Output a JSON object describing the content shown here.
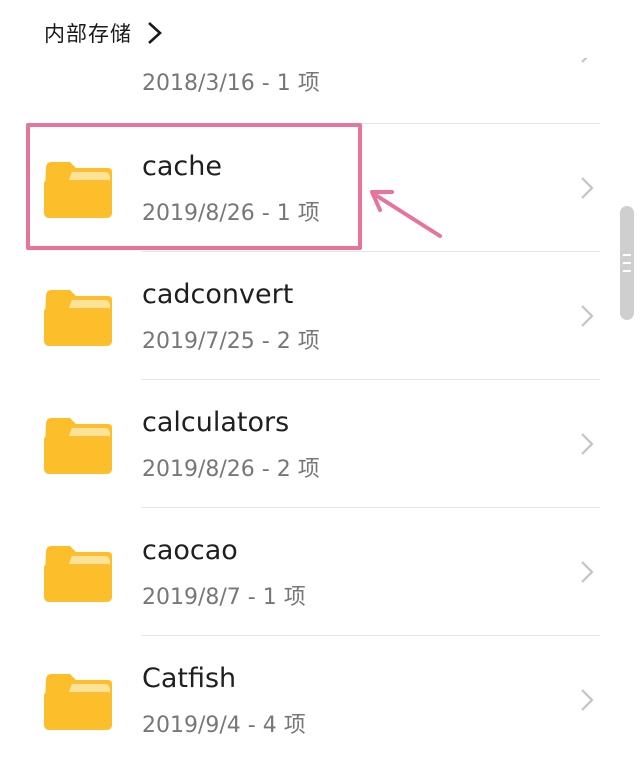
{
  "breadcrumb": {
    "label": "内部存储"
  },
  "folders": [
    {
      "name": "",
      "meta": "2018/3/16 - 1 项"
    },
    {
      "name": "cache",
      "meta": "2019/8/26 - 1 项"
    },
    {
      "name": "cadconvert",
      "meta": "2019/7/25 - 2 项"
    },
    {
      "name": "calculators",
      "meta": "2019/8/26 - 2 项"
    },
    {
      "name": "caocao",
      "meta": "2019/8/7 - 1 项"
    },
    {
      "name": "Catfish",
      "meta": "2019/9/4 - 4 项"
    }
  ],
  "colors": {
    "folder": "#FDBE2B",
    "folder_tab": "#FFE29A",
    "highlight": "#E8739B",
    "divider": "#E3E3E3"
  }
}
